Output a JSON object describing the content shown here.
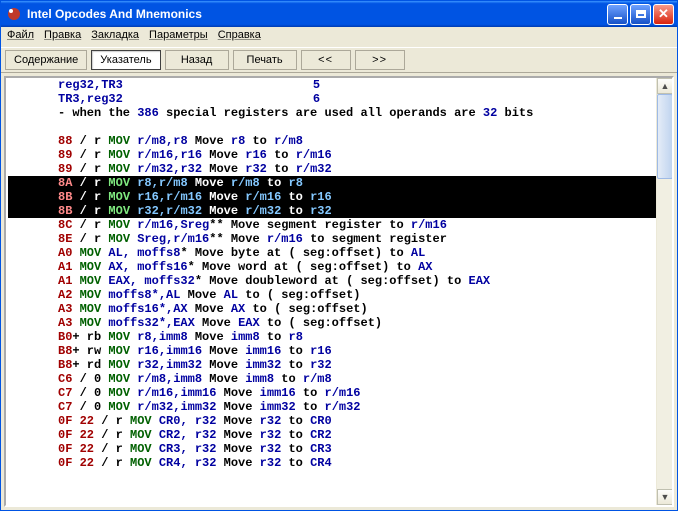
{
  "window": {
    "title": "Intel Opcodes And Mnemonics"
  },
  "menu": {
    "file": "Файл",
    "edit": "Правка",
    "bookmark": "Закладка",
    "options": "Параметры",
    "help": "Справка"
  },
  "toolbar": {
    "contents": "Содержание",
    "index": "Указатель",
    "back": "Назад",
    "print": "Печать",
    "prev": "<<",
    "next": ">>"
  },
  "header": {
    "l1a": "reg32,TR3",
    "l1b": "5",
    "l2a": "TR3,reg32",
    "l2b": "6",
    "l3a": "- when the ",
    "l3b": "386",
    "l3c": " special registers are used all operands are ",
    "l3d": "32",
    "l3e": " bits"
  },
  "rows": [
    {
      "op": "88",
      "sep": " / r ",
      "mn": "MOV ",
      "arg": "r/m8,r8",
      "d1": " Move ",
      "d2": "r8",
      "d3": " to ",
      "d4": "r/m8"
    },
    {
      "op": "89",
      "sep": " / r ",
      "mn": "MOV ",
      "arg": "r/m16,r16",
      "d1": " Move ",
      "d2": "r16",
      "d3": " to ",
      "d4": "r/m16"
    },
    {
      "op": "89",
      "sep": " / r ",
      "mn": "MOV ",
      "arg": "r/m32,r32",
      "d1": " Move ",
      "d2": "r32",
      "d3": " to ",
      "d4": "r/m32"
    },
    {
      "sel": true,
      "op": "8A",
      "sep": " / r ",
      "mn": "MOV ",
      "arg": "r8,r/m8",
      "d1": " Move ",
      "d2": "r/m8",
      "d3": " to ",
      "d4": "r8"
    },
    {
      "sel": true,
      "op": "8B",
      "sep": " / r ",
      "mn": "MOV ",
      "arg": "r16,r/m16",
      "d1": " Move ",
      "d2": "r/m16",
      "d3": " to ",
      "d4": "r16"
    },
    {
      "sel": true,
      "op": "8B",
      "sep": " / r ",
      "mn": "MOV ",
      "arg": "r32,r/m32",
      "d1": " Move ",
      "d2": "r/m32",
      "d3": " to ",
      "d4": "r32"
    },
    {
      "op": "8C",
      "sep": " / r ",
      "mn": "MOV ",
      "arg": "r/m16,Sreg",
      "tail": "** Move segment register to ",
      "tail2": "r/m16"
    },
    {
      "op": "8E",
      "sep": " / r ",
      "mn": "MOV ",
      "arg": "Sreg,r/m16",
      "tail": "** Move ",
      "tail1": "r/m16",
      "tail3": " to segment register"
    },
    {
      "op": "A0",
      "sep": " ",
      "mn": "MOV ",
      "arg": "AL, moffs8",
      "tail": "* Move byte at ( seg:offset) to ",
      "tail2": "AL"
    },
    {
      "op": "A1",
      "sep": " ",
      "mn": "MOV ",
      "arg": "AX, moffs16",
      "tail": "* Move word at ( seg:offset) to ",
      "tail2": "AX"
    },
    {
      "op": "A1",
      "sep": " ",
      "mn": "MOV ",
      "arg": "EAX, moffs32",
      "tail": "* Move doubleword at ( seg:offset) to ",
      "tail2": "EAX"
    },
    {
      "op": "A2",
      "sep": " ",
      "mn": "MOV ",
      "arg": "moffs8*,AL",
      "tail": " Move ",
      "tail1": "AL",
      "tail3": " to ( seg:offset)"
    },
    {
      "op": "A3",
      "sep": " ",
      "mn": "MOV ",
      "arg": "moffs16*,AX",
      "tail": " Move ",
      "tail1": "AX",
      "tail3": " to ( seg:offset)"
    },
    {
      "op": "A3",
      "sep": " ",
      "mn": "MOV ",
      "arg": "moffs32*,EAX",
      "tail": " Move ",
      "tail1": "EAX",
      "tail3": " to ( seg:offset)"
    },
    {
      "op": "B0",
      "sep": "+ rb ",
      "mn": "MOV ",
      "arg": "r8,imm8",
      "d1": " Move ",
      "d2": "imm8",
      "d3": " to ",
      "d4": "r8"
    },
    {
      "op": "B8",
      "sep": "+ rw ",
      "mn": "MOV ",
      "arg": "r16,imm16",
      "d1": " Move ",
      "d2": "imm16",
      "d3": " to ",
      "d4": "r16"
    },
    {
      "op": "B8",
      "sep": "+ rd ",
      "mn": "MOV ",
      "arg": "r32,imm32",
      "d1": " Move ",
      "d2": "imm32",
      "d3": " to ",
      "d4": "r32"
    },
    {
      "op": "C6",
      "sep": " / 0 ",
      "mn": "MOV ",
      "arg": "r/m8,imm8",
      "d1": " Move ",
      "d2": "imm8",
      "d3": " to ",
      "d4": "r/m8"
    },
    {
      "op": "C7",
      "sep": " / 0 ",
      "mn": "MOV ",
      "arg": "r/m16,imm16",
      "d1": " Move ",
      "d2": "imm16",
      "d3": " to ",
      "d4": "r/m16"
    },
    {
      "op": "C7",
      "sep": " / 0 ",
      "mn": "MOV ",
      "arg": "r/m32,imm32",
      "d1": " Move ",
      "d2": "imm32",
      "d3": " to ",
      "d4": "r/m32"
    },
    {
      "op": "0F 22",
      "sep": " / r ",
      "mn": "MOV ",
      "arg": "CR0, r32",
      "d1": " Move ",
      "d2": "r32",
      "d3": " to ",
      "d4": "CR0"
    },
    {
      "op": "0F 22",
      "sep": " / r ",
      "mn": "MOV ",
      "arg": "CR2, r32",
      "d1": " Move ",
      "d2": "r32",
      "d3": " to ",
      "d4": "CR2"
    },
    {
      "op": "0F 22",
      "sep": " / r ",
      "mn": "MOV ",
      "arg": "CR3, r32",
      "d1": " Move ",
      "d2": "r32",
      "d3": " to ",
      "d4": "CR3"
    },
    {
      "op": "0F 22",
      "sep": " / r ",
      "mn": "MOV ",
      "arg": "CR4, r32",
      "d1": " Move ",
      "d2": "r32",
      "d3": " to ",
      "d4": "CR4"
    }
  ]
}
